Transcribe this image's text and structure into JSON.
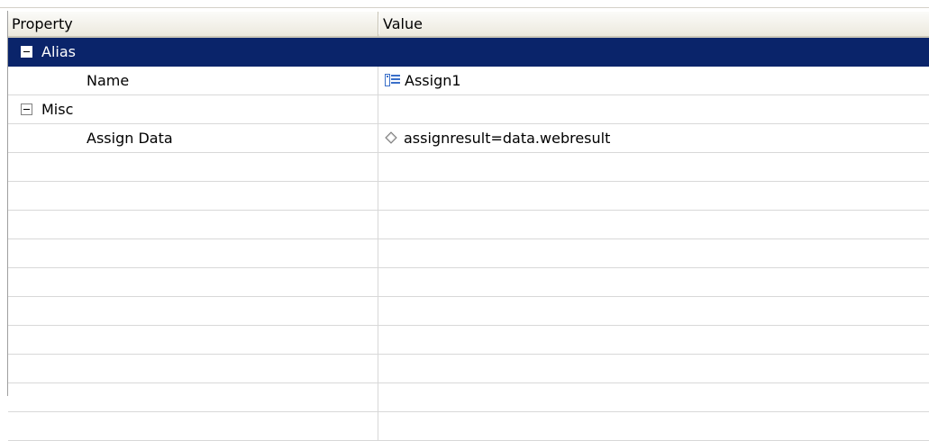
{
  "columns": {
    "property": "Property",
    "value": "Value"
  },
  "rows": [
    {
      "kind": "category",
      "label": "Alias",
      "value": "",
      "selected": true,
      "toggle": "collapse-icon"
    },
    {
      "kind": "property",
      "label": "Name",
      "value": "Assign1",
      "icon": "list-icon"
    },
    {
      "kind": "category",
      "label": "Misc",
      "value": "",
      "selected": false,
      "toggle": "collapse-icon"
    },
    {
      "kind": "property",
      "label": "Assign Data",
      "value": "assignresult=data.webresult",
      "icon": "diamond-icon"
    }
  ],
  "colors": {
    "selection": "#0a246a",
    "gridline": "#d8d8d8",
    "header": "#ece9dd"
  }
}
